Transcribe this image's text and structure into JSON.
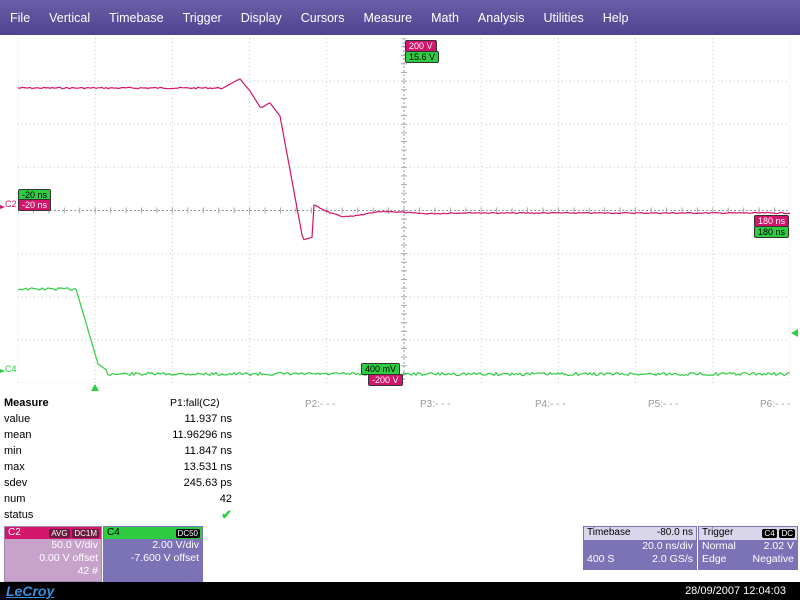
{
  "menu": [
    "File",
    "Vertical",
    "Timebase",
    "Trigger",
    "Display",
    "Cursors",
    "Measure",
    "Math",
    "Analysis",
    "Utilities",
    "Help"
  ],
  "colors": {
    "c2": "#d4156c",
    "c4": "#2ecc40",
    "accent": "#5b4f99",
    "grid": "#c8c8c8"
  },
  "labels": {
    "c2_scale_top": "200 V",
    "c4_scale_top": "15.6 V",
    "c4_left_time": "-20 ns",
    "c2_left_time": "-20 ns",
    "c2_right_time": "180 ns",
    "c4_right_time": "180 ns",
    "c4_bottom": "400 mV",
    "c2_bottom": "-200 V",
    "c2_marker": "C2",
    "c4_marker": "C4"
  },
  "measure": {
    "title": "Measure",
    "param": "P1:fall(C2)",
    "rows": [
      {
        "label": "value",
        "value": "11.937 ns"
      },
      {
        "label": "mean",
        "value": "11.96296 ns"
      },
      {
        "label": "min",
        "value": "11.847 ns"
      },
      {
        "label": "max",
        "value": "13.531 ns"
      },
      {
        "label": "sdev",
        "value": "245.63 ps"
      },
      {
        "label": "num",
        "value": "42"
      },
      {
        "label": "status",
        "value": "✔"
      }
    ],
    "others": [
      "P2:- - -",
      "P3:- - -",
      "P4:- - -",
      "P5:- - -",
      "P6:- - -"
    ]
  },
  "c2box": {
    "name": "C2",
    "badge1": "AVG",
    "badge2": "DC1M",
    "vdiv": "50.0 V/div",
    "offset": "0.00 V offset",
    "sweeps": "42 #"
  },
  "c4box": {
    "name": "C4",
    "badge": "DC50",
    "vdiv": "2.00 V/div",
    "offset": "-7.600 V offset"
  },
  "timebase": {
    "title": "Timebase",
    "delay": "-80.0 ns",
    "tdiv": "20.0 ns/div",
    "samples": "400 S",
    "rate": "2.0 GS/s"
  },
  "trigger": {
    "title": "Trigger",
    "badge": "C4",
    "badge2": "DC",
    "mode": "Normal",
    "level": "2.02 V",
    "type": "Edge",
    "slope": "Negative"
  },
  "status": {
    "logo": "LeCroy",
    "datetime": "28/09/2007 12:04:03"
  }
}
